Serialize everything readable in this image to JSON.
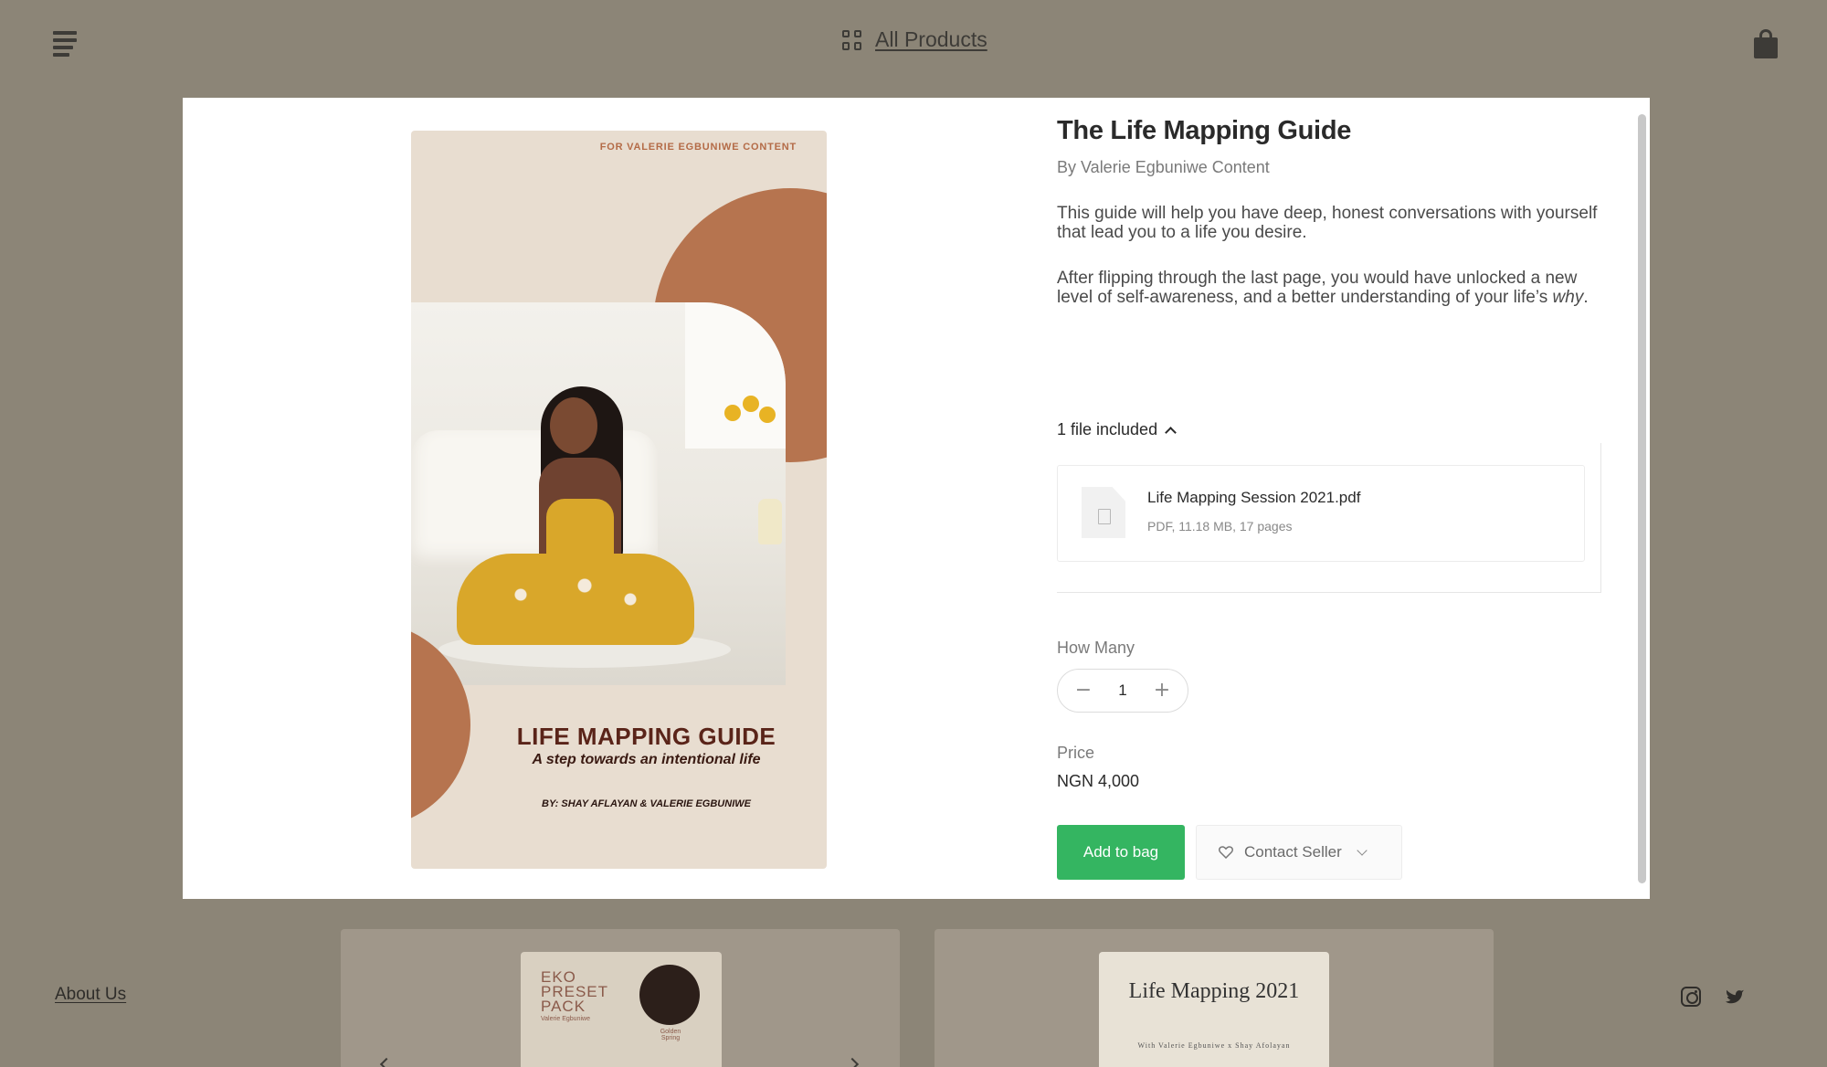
{
  "header": {
    "all_products_label": "All Products"
  },
  "product": {
    "title": "The Life Mapping Guide",
    "author": "By Valerie Egbuniwe Content",
    "description_1": "This guide will help you have deep, honest conversations with yourself that lead you to a life you desire.",
    "description_2_prefix": "After flipping through the last page, you would have unlocked a new level of self-awareness, and a better understanding of your life’s ",
    "description_2_emphasis": "why",
    "description_2_suffix": ".",
    "files_toggle_label": "1 file included",
    "file": {
      "name": "Life Mapping Session 2021.pdf",
      "meta": "PDF, 11.18 MB, 17 pages"
    },
    "quantity_label": "How Many",
    "quantity_value": "1",
    "price_label": "Price",
    "price_value": "NGN 4,000",
    "add_to_bag_label": "Add to bag",
    "contact_seller_label": "Contact Seller"
  },
  "cover": {
    "top_text": "FOR VALERIE EGBUNIWE CONTENT",
    "title": "LIFE MAPPING GUIDE",
    "subtitle": "A step towards an intentional life",
    "byline": "BY: SHAY AFLAYAN & VALERIE EGBUNIWE"
  },
  "background_cards": {
    "card1": {
      "title": "EKO PRESET PACK",
      "subtitle": "Valerie Egbuniwe",
      "caption": "Golden Spring"
    },
    "card2": {
      "title": "Life Mapping 2021",
      "with_text": "With Valerie Egbuniwe x Shay Afolayan"
    }
  },
  "footer": {
    "about_label": "About Us"
  },
  "colors": {
    "backdrop": "#8c8577",
    "accent_green": "#34b561",
    "cover_terracotta": "#b6744f",
    "cover_title": "#5a2419"
  },
  "icons": [
    "menu-icon",
    "grid-icon",
    "shopping-bag-icon",
    "file-icon",
    "chevron-up-icon",
    "heart-icon",
    "chevron-down-icon",
    "instagram-icon",
    "twitter-icon"
  ]
}
